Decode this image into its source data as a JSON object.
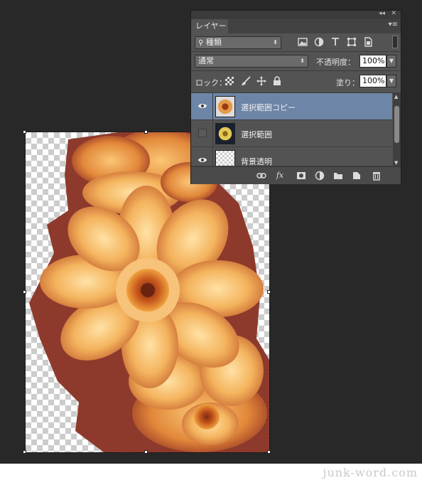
{
  "panel": {
    "tab_label": "レイヤー",
    "titlebar": {
      "collapse_glyph": "◂◂",
      "close_glyph": "✕"
    },
    "menu_glyph": "▾≡",
    "filter": {
      "kind_value": "種類",
      "icons": [
        "image-filter-icon",
        "adjustment-filter-icon",
        "type-filter-icon",
        "shape-filter-icon",
        "smart-object-filter-icon"
      ]
    },
    "blend": {
      "mode_value": "通常",
      "opacity_label": "不透明度：",
      "opacity_value": "100%"
    },
    "lock": {
      "label": "ロック：",
      "fill_label": "塗り：",
      "fill_value": "100%"
    },
    "layers": [
      {
        "name": "選択範囲コピー",
        "visible": true,
        "selected": true
      },
      {
        "name": "選択範囲",
        "visible": false,
        "selected": false
      },
      {
        "name": "背景透明",
        "visible": true,
        "selected": false
      }
    ],
    "bottom_icons": [
      "link-layers-icon",
      "fx-icon",
      "layer-mask-icon",
      "adjustment-layer-icon",
      "new-group-icon",
      "new-layer-icon",
      "trash-icon"
    ],
    "fx_label": "fx",
    "selected_color": "#6d85a6"
  },
  "document": {
    "content": "dahlia-flower-image"
  },
  "watermark": "junk-word.com"
}
